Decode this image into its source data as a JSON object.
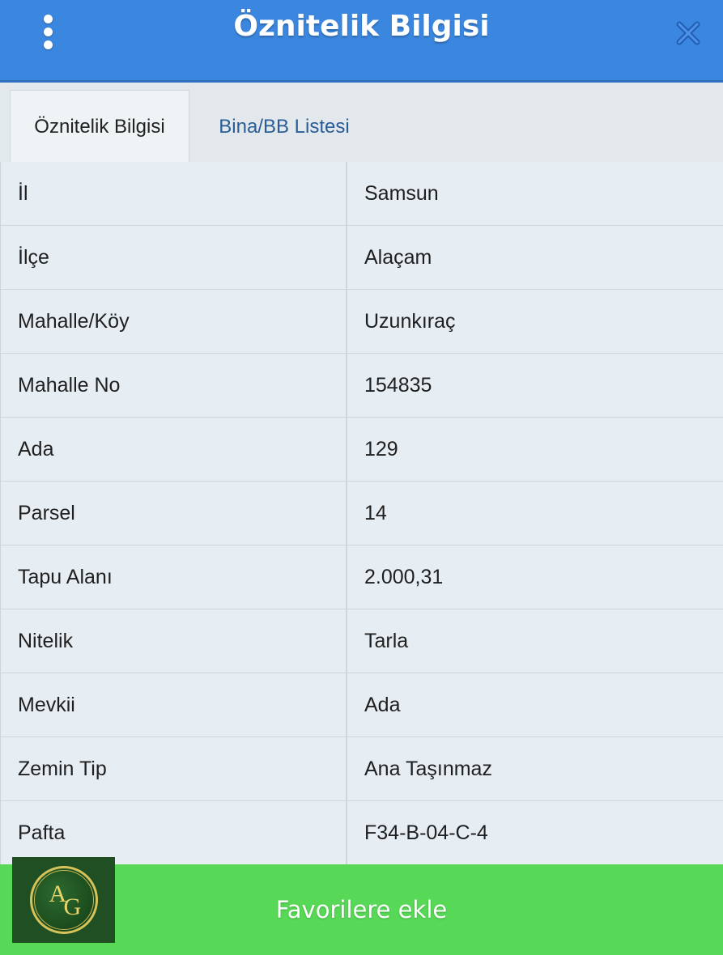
{
  "header": {
    "title": "Öznitelik Bilgisi",
    "menu_icon": "vertical-ellipsis-icon",
    "close_icon": "close-icon",
    "bg_color": "#3b87e0"
  },
  "tabs": [
    {
      "label": "Öznitelik Bilgisi",
      "active": true
    },
    {
      "label": "Bina/BB Listesi",
      "active": false
    }
  ],
  "attributes": [
    {
      "label": "İl",
      "value": "Samsun"
    },
    {
      "label": "İlçe",
      "value": "Alaçam"
    },
    {
      "label": "Mahalle/Köy",
      "value": "Uzunkıraç"
    },
    {
      "label": "Mahalle No",
      "value": "154835"
    },
    {
      "label": "Ada",
      "value": "129"
    },
    {
      "label": "Parsel",
      "value": "14"
    },
    {
      "label": "Tapu Alanı",
      "value": "2.000,31"
    },
    {
      "label": "Nitelik",
      "value": "Tarla"
    },
    {
      "label": "Mevkii",
      "value": "Ada"
    },
    {
      "label": "Zemin Tip",
      "value": "Ana Taşınmaz"
    },
    {
      "label": "Pafta",
      "value": "F34-B-04-C-4"
    }
  ],
  "footer": {
    "button_label": "Favorilere ekle",
    "bg_color": "#57d856"
  },
  "logo": {
    "letters": "AG"
  }
}
